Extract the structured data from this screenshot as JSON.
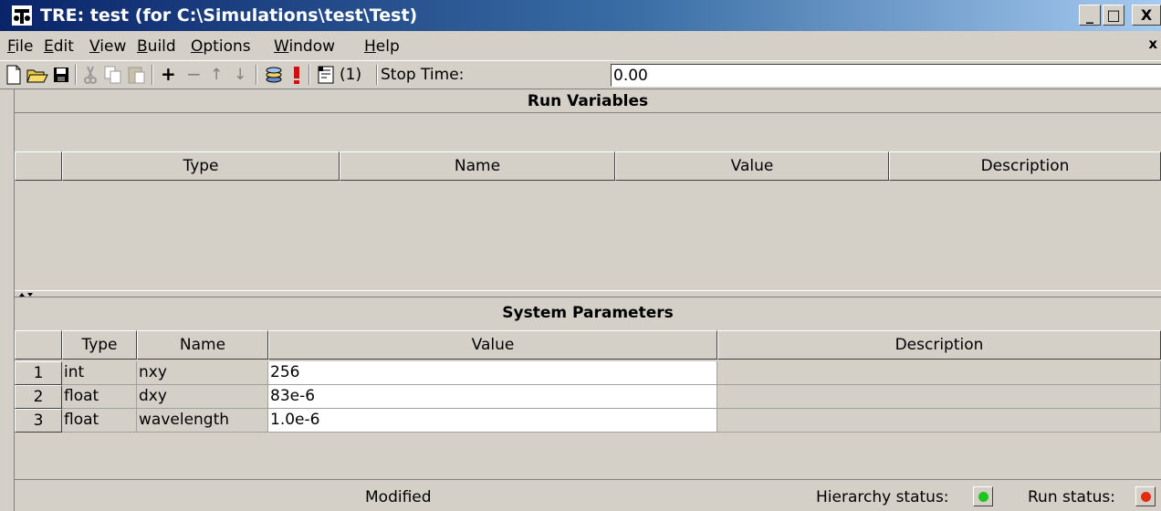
{
  "window": {
    "title": "TRE:  test (for C:\\Simulations\\test\\Test)",
    "minimize": "_",
    "maximize": "□",
    "close": "X"
  },
  "menu": {
    "items": [
      {
        "u": "F",
        "rest": "ile"
      },
      {
        "u": "E",
        "rest": "dit"
      },
      {
        "u": "V",
        "rest": "iew"
      },
      {
        "u": "B",
        "rest": "uild"
      },
      {
        "u": "O",
        "rest": "ptions"
      },
      {
        "u": "W",
        "rest": "indow"
      },
      {
        "u": "H",
        "rest": "elp"
      }
    ],
    "mdi_close": "x"
  },
  "toolbar": {
    "add": "+",
    "remove": "−",
    "up": "↑",
    "down": "↓",
    "run_count": "(1)",
    "stop_time_label": "Stop Time:",
    "stop_time_value": "0.00"
  },
  "run_variables": {
    "title": "Run Variables",
    "columns": [
      "Type",
      "Name",
      "Value",
      "Description"
    ]
  },
  "system_parameters": {
    "title": "System Parameters",
    "columns": [
      "Type",
      "Name",
      "Value",
      "Description"
    ],
    "rows": [
      {
        "num": "1",
        "type": "int",
        "name": "nxy",
        "value": "256",
        "description": ""
      },
      {
        "num": "2",
        "type": "float",
        "name": "dxy",
        "value": "83e-6",
        "description": ""
      },
      {
        "num": "3",
        "type": "float",
        "name": "wavelength",
        "value": "1.0e-6",
        "description": ""
      }
    ]
  },
  "status": {
    "state": "Modified",
    "hierarchy_label": "Hierarchy status:",
    "run_label": "Run status:",
    "hierarchy_color": "#1ec51e",
    "run_color": "#e52a10"
  }
}
